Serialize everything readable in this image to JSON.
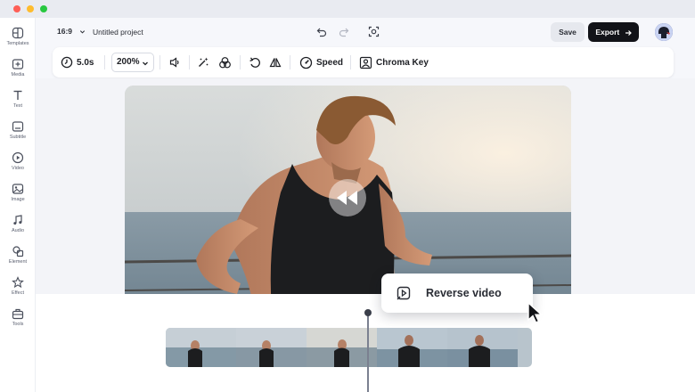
{
  "sidebar": {
    "items": [
      {
        "label": "Templates",
        "icon": "templates-icon"
      },
      {
        "label": "Media",
        "icon": "media-icon"
      },
      {
        "label": "Text",
        "icon": "text-icon"
      },
      {
        "label": "Subtitle",
        "icon": "subtitle-icon"
      },
      {
        "label": "Video",
        "icon": "video-icon"
      },
      {
        "label": "Image",
        "icon": "image-icon"
      },
      {
        "label": "Audio",
        "icon": "audio-icon"
      },
      {
        "label": "Element",
        "icon": "element-icon"
      },
      {
        "label": "Effect",
        "icon": "effect-icon"
      },
      {
        "label": "Tools",
        "icon": "tools-icon"
      }
    ]
  },
  "topbar": {
    "aspect_ratio": "16:9",
    "project_title": "Untitled project",
    "save_label": "Save",
    "export_label": "Export"
  },
  "toolbar": {
    "duration": "5.0s",
    "zoom": "200%",
    "speed_label": "Speed",
    "chroma_key_label": "Chroma Key"
  },
  "tooltip": {
    "label": "Reverse video"
  },
  "colors": {
    "accent_dark": "#121318",
    "save_bg": "#e6e8ee",
    "window_close": "#fe5f57",
    "window_min": "#febc2e",
    "window_max": "#28c840"
  }
}
